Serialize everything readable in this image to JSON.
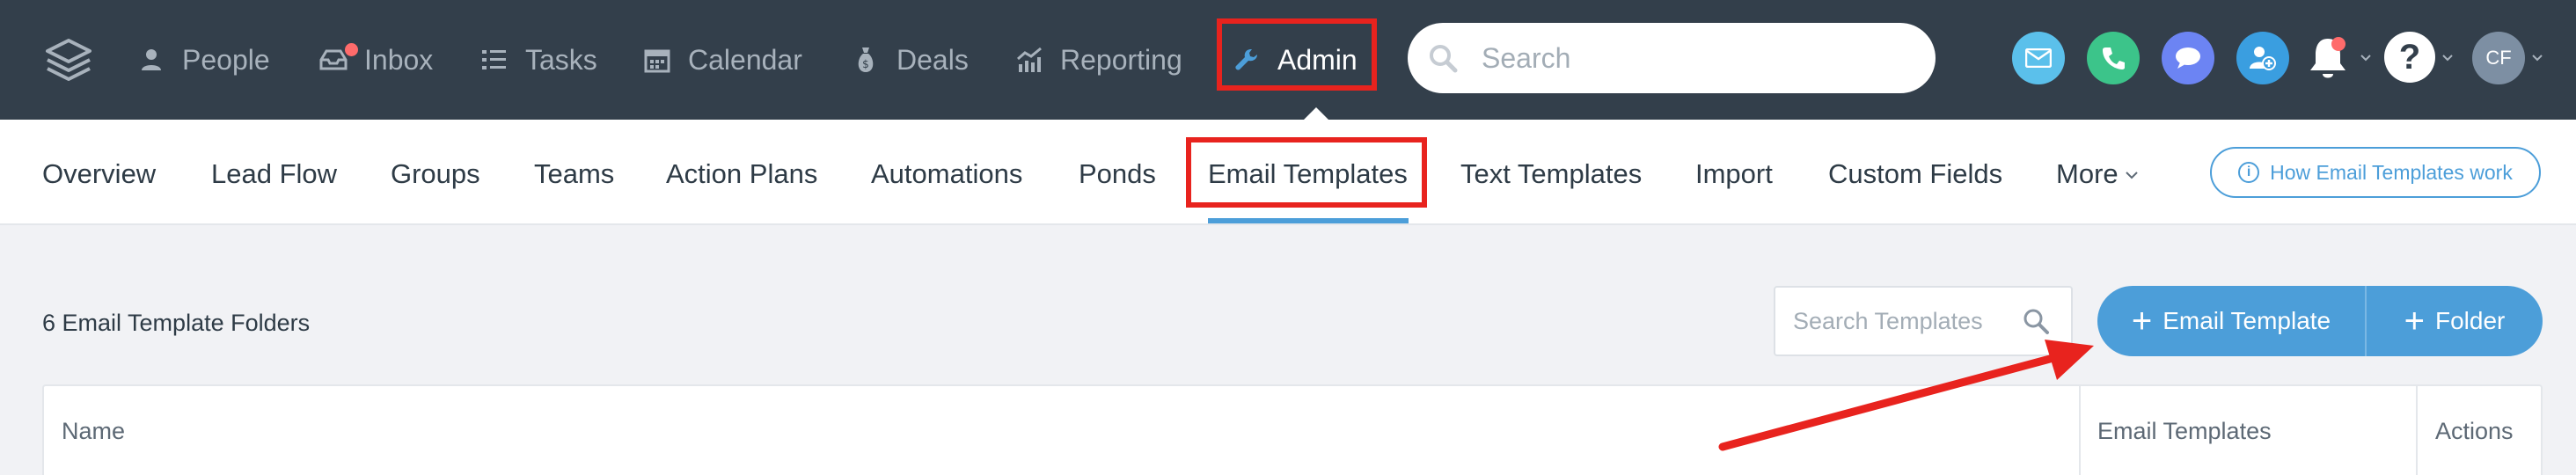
{
  "topnav": {
    "items": [
      {
        "label": "People",
        "icon": "person-icon"
      },
      {
        "label": "Inbox",
        "icon": "inbox-icon",
        "has_notification": true
      },
      {
        "label": "Tasks",
        "icon": "tasks-list-icon"
      },
      {
        "label": "Calendar",
        "icon": "calendar-icon"
      },
      {
        "label": "Deals",
        "icon": "money-bag-icon"
      },
      {
        "label": "Reporting",
        "icon": "chart-icon"
      }
    ],
    "admin": {
      "label": "Admin",
      "icon": "wrench-icon"
    },
    "search_placeholder": "Search",
    "avatar_initials": "CF"
  },
  "colors": {
    "topbar": "#333f4b",
    "accent": "#4c9ed9",
    "highlight": "#e8231e",
    "email_btn": "#5bc0eb",
    "call_btn": "#3cc48a",
    "chat_btn": "#6c84f3",
    "contact_btn": "#3a9ee0"
  },
  "subnav": {
    "tabs": [
      "Overview",
      "Lead Flow",
      "Groups",
      "Teams",
      "Action Plans",
      "Automations",
      "Ponds",
      "Email Templates",
      "Text Templates",
      "Import",
      "Custom Fields",
      "More"
    ],
    "active_tab": "Email Templates",
    "help_link": "How Email Templates work"
  },
  "content": {
    "folder_count": "6 Email Template Folders",
    "search_templates_placeholder": "Search Templates",
    "add_template_label": "Email Template",
    "add_folder_label": "Folder",
    "table_headers": {
      "name": "Name",
      "email_templates": "Email Templates",
      "actions": "Actions"
    }
  }
}
